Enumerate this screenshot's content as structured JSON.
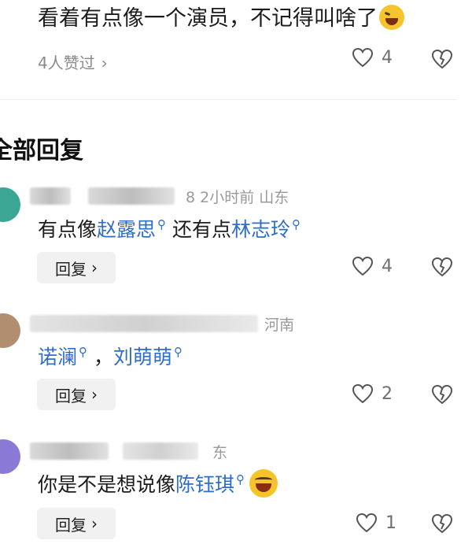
{
  "top_comment": {
    "text": "看着有点像一个演员，不记得叫啥了",
    "liked_by": "4人赞过",
    "like_count": "4"
  },
  "section": {
    "title": "全部回复"
  },
  "replies": [
    {
      "meta_visible": "8  2小时前  山东",
      "text_before": "有点像",
      "link1": "赵露思",
      "text_mid": " 还有点",
      "link2": "林志玲",
      "reply_label": "回复",
      "like_count": "4"
    },
    {
      "meta_visible": "河南",
      "link1": "诺澜",
      "text_mid": " ，",
      "link2": "刘萌萌",
      "reply_label": "回复",
      "like_count": "2"
    },
    {
      "meta_visible": "东",
      "text_before": "你是不是想说像",
      "link1": "陈钰琪",
      "reply_label": "回复",
      "like_count": "1"
    }
  ],
  "icons": {
    "search_sup": "search-icon",
    "heart": "heart-icon",
    "dislike": "broken-heart-icon",
    "chevron": "chevron-right-icon"
  },
  "colors": {
    "link": "#2f6ec8",
    "meta": "#999999",
    "accent_emoji": "#f6c428"
  }
}
